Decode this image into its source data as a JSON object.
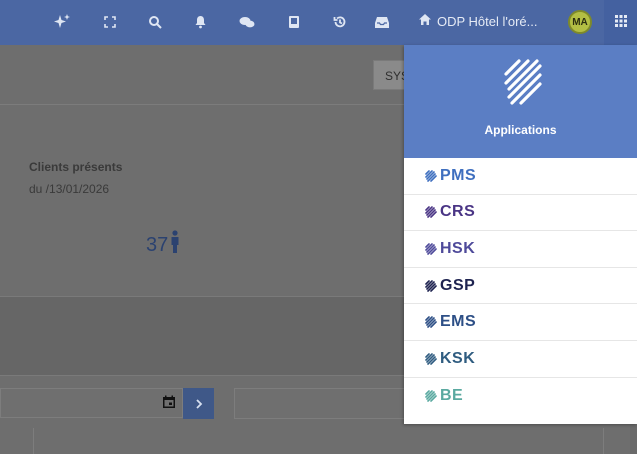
{
  "topbar": {
    "hotel_name": "ODP Hôtel l'oré...",
    "avatar_initials": "MA",
    "icons": [
      "sparkle-icon",
      "fullscreen-icon",
      "search-icon",
      "bell-icon",
      "chat-icon",
      "book-icon",
      "history-icon",
      "inbox-icon",
      "home-icon",
      "apps-grid-icon"
    ]
  },
  "page": {
    "sys_button_label": "SYS",
    "clients_title": "Clients présents",
    "clients_date": "du /13/01/2026",
    "clients_count": "37"
  },
  "apps_menu": {
    "title": "Applications",
    "items": [
      {
        "label": "PMS",
        "color": "#3f6fbf"
      },
      {
        "label": "CRS",
        "color": "#4a3585"
      },
      {
        "label": "HSK",
        "color": "#4e4a9a"
      },
      {
        "label": "GSP",
        "color": "#1e2350"
      },
      {
        "label": "EMS",
        "color": "#2d4f86"
      },
      {
        "label": "KSK",
        "color": "#2f5c80"
      },
      {
        "label": "BE",
        "color": "#5aa9a0"
      }
    ]
  }
}
